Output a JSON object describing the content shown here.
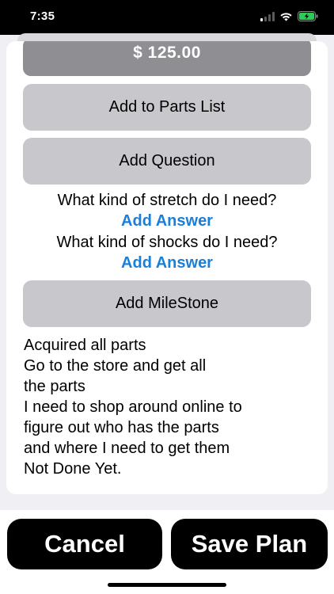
{
  "status_bar": {
    "time": "7:35",
    "icons": [
      "cellular-signal-icon",
      "wifi-icon",
      "battery-charging-icon"
    ],
    "battery_color": "#34c759"
  },
  "card": {
    "price": "$ 125.00",
    "add_parts_label": "Add to Parts List",
    "add_question_label": "Add Question",
    "questions": [
      {
        "text": "What kind of stretch do I need?",
        "answer_label": "Add Answer"
      },
      {
        "text": "What kind of shocks do I need?",
        "answer_label": "Add Answer"
      }
    ],
    "add_milestone_label": "Add MileStone",
    "milestone_lines": [
      "Acquired all parts",
      "Go to the store and get all",
      "the parts",
      "I need to shop around online to",
      "figure out who has the parts",
      "and where I need to get them",
      "Not Done Yet."
    ]
  },
  "bottom_bar": {
    "cancel_label": "Cancel",
    "save_label": "Save Plan"
  },
  "colors": {
    "link": "#1a7fd9",
    "button_gray": "#c7c7cc",
    "price_gray": "#8e8e93",
    "sheet_background": "#efeff4"
  }
}
